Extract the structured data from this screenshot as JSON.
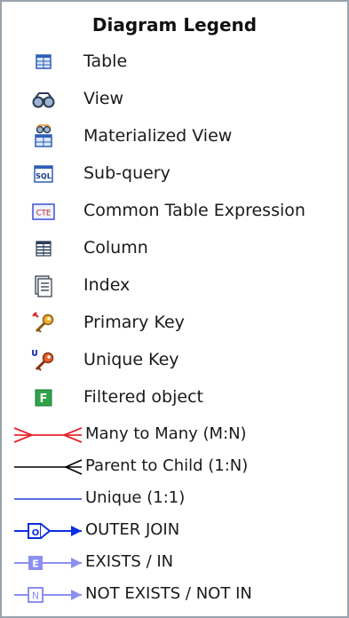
{
  "legend": {
    "title": "Diagram Legend",
    "items": [
      {
        "label": "Table",
        "icon": "table-icon"
      },
      {
        "label": "View",
        "icon": "view-icon"
      },
      {
        "label": "Materialized View",
        "icon": "materialized-view-icon"
      },
      {
        "label": "Sub-query",
        "icon": "sql-subquery-icon",
        "icon_text": "SQL"
      },
      {
        "label": "Common Table Expression",
        "icon": "cte-icon",
        "icon_text": "CTE"
      },
      {
        "label": "Column",
        "icon": "column-icon"
      },
      {
        "label": "Index",
        "icon": "index-icon"
      },
      {
        "label": "Primary Key",
        "icon": "primary-key-icon"
      },
      {
        "label": "Unique Key",
        "icon": "unique-key-icon"
      },
      {
        "label": "Filtered object",
        "icon": "filtered-object-icon",
        "icon_text": "F"
      }
    ],
    "relations": [
      {
        "label": "Many to Many (M:N)",
        "icon": "many-to-many-line-icon",
        "color": "#e8262c"
      },
      {
        "label": "Parent to Child (1:N)",
        "icon": "parent-to-child-line-icon",
        "color": "#000000"
      },
      {
        "label": "Unique (1:1)",
        "icon": "unique-line-icon",
        "color": "#1f3fd8"
      },
      {
        "label": "OUTER JOIN",
        "icon": "outer-join-icon",
        "color": "#0b2ee0",
        "icon_text": "O"
      },
      {
        "label": "EXISTS / IN",
        "icon": "exists-in-icon",
        "color": "#8c8ff0",
        "icon_text": "E"
      },
      {
        "label": "NOT EXISTS / NOT IN",
        "icon": "not-exists-icon",
        "color": "#8c8ff0",
        "icon_text": "N"
      }
    ]
  }
}
